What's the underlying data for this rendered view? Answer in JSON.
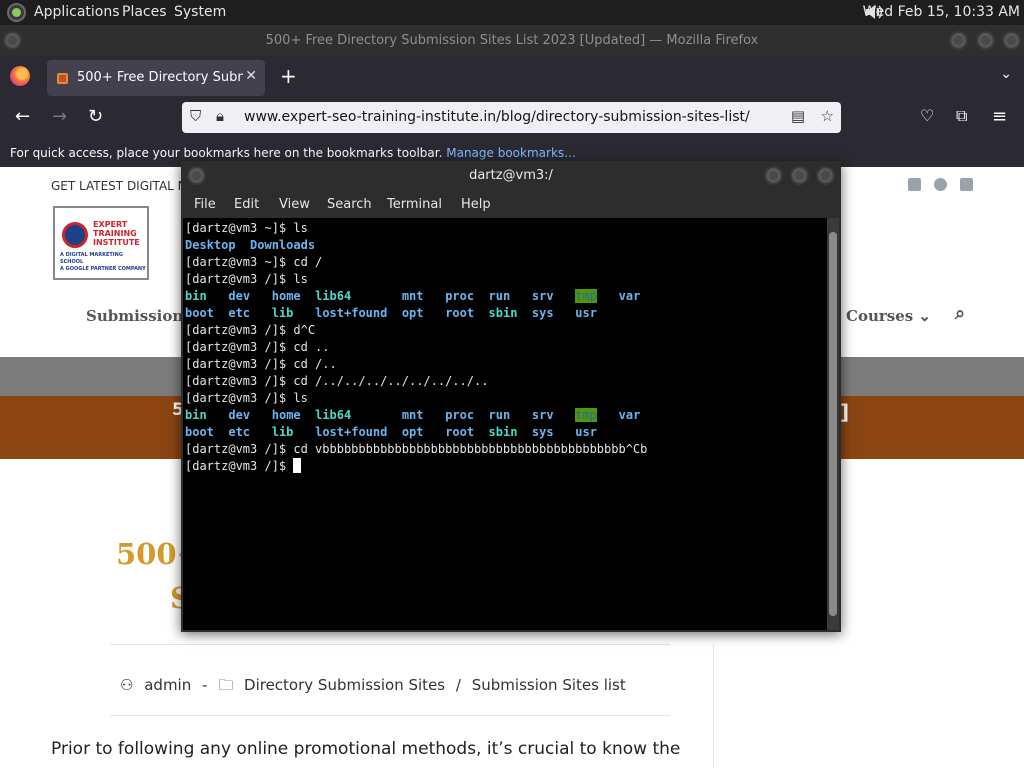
{
  "panel": {
    "menus": [
      "Applications",
      "Places",
      "System"
    ],
    "clock": "Wed Feb 15, 10:33 AM"
  },
  "firefox": {
    "window_title": "500+ Free Directory Submission Sites List 2023 [Updated] — Mozilla Firefox",
    "tab_title": "500+ Free Directory Submis",
    "url": "www.expert-seo-training-institute.in/blog/directory-submission-sites-list/",
    "bookmarks_text": "For quick access, place your bookmarks here on the bookmarks toolbar.",
    "bookmarks_link": "Manage bookmarks…"
  },
  "webpage": {
    "topline": "GET LATEST DIGITAL MA",
    "logo_lines": [
      "EXPERT",
      "TRAINING",
      "INSTITUTE"
    ],
    "logo_sub": [
      "A DIGITAL MARKETING SCHOOL",
      "A GOOGLE PARTNER COMPANY"
    ],
    "nav_left": "Submission S",
    "nav_right": "Courses",
    "banner_left": "5",
    "banner_right": "]",
    "heading_line1": "500+",
    "heading_line2": "S",
    "author": "admin",
    "category1": "Directory Submission Sites",
    "category2": "Submission Sites list",
    "paragraph": "Prior to following any online promotional methods, it’s crucial to know the"
  },
  "terminal": {
    "title": "dartz@vm3:/",
    "menu": [
      "File",
      "Edit",
      "View",
      "Search",
      "Terminal",
      "Help"
    ],
    "lines": [
      [
        {
          "t": "[dartz@vm3 ~]$ ls"
        }
      ],
      [
        {
          "t": "Desktop",
          "c": "dir"
        },
        {
          "t": "  "
        },
        {
          "t": "Downloads",
          "c": "dir"
        }
      ],
      [
        {
          "t": "[dartz@vm3 ~]$ cd /"
        }
      ],
      [
        {
          "t": "[dartz@vm3 /]$ ls"
        }
      ],
      [
        {
          "t": "bin",
          "c": "link"
        },
        {
          "t": "   "
        },
        {
          "t": "dev",
          "c": "dir"
        },
        {
          "t": "   "
        },
        {
          "t": "home",
          "c": "dir"
        },
        {
          "t": "  "
        },
        {
          "t": "lib64",
          "c": "link"
        },
        {
          "t": "       "
        },
        {
          "t": "mnt",
          "c": "dir"
        },
        {
          "t": "   "
        },
        {
          "t": "proc",
          "c": "dir"
        },
        {
          "t": "  "
        },
        {
          "t": "run",
          "c": "dir"
        },
        {
          "t": "   "
        },
        {
          "t": "srv",
          "c": "dir"
        },
        {
          "t": "   "
        },
        {
          "t": "tmp",
          "c": "hl"
        },
        {
          "t": "   "
        },
        {
          "t": "var",
          "c": "dir"
        }
      ],
      [
        {
          "t": "boot",
          "c": "dir"
        },
        {
          "t": "  "
        },
        {
          "t": "etc",
          "c": "dir"
        },
        {
          "t": "   "
        },
        {
          "t": "lib",
          "c": "link"
        },
        {
          "t": "   "
        },
        {
          "t": "lost+found",
          "c": "dir"
        },
        {
          "t": "  "
        },
        {
          "t": "opt",
          "c": "dir"
        },
        {
          "t": "   "
        },
        {
          "t": "root",
          "c": "dir"
        },
        {
          "t": "  "
        },
        {
          "t": "sbin",
          "c": "link"
        },
        {
          "t": "  "
        },
        {
          "t": "sys",
          "c": "dir"
        },
        {
          "t": "   "
        },
        {
          "t": "usr",
          "c": "dir"
        }
      ],
      [
        {
          "t": "[dartz@vm3 /]$ d^C"
        }
      ],
      [
        {
          "t": "[dartz@vm3 /]$ cd .."
        }
      ],
      [
        {
          "t": "[dartz@vm3 /]$ cd /.."
        }
      ],
      [
        {
          "t": "[dartz@vm3 /]$ cd /../../../../../../../.."
        }
      ],
      [
        {
          "t": "[dartz@vm3 /]$ ls"
        }
      ],
      [
        {
          "t": "bin",
          "c": "link"
        },
        {
          "t": "   "
        },
        {
          "t": "dev",
          "c": "dir"
        },
        {
          "t": "   "
        },
        {
          "t": "home",
          "c": "dir"
        },
        {
          "t": "  "
        },
        {
          "t": "lib64",
          "c": "link"
        },
        {
          "t": "       "
        },
        {
          "t": "mnt",
          "c": "dir"
        },
        {
          "t": "   "
        },
        {
          "t": "proc",
          "c": "dir"
        },
        {
          "t": "  "
        },
        {
          "t": "run",
          "c": "dir"
        },
        {
          "t": "   "
        },
        {
          "t": "srv",
          "c": "dir"
        },
        {
          "t": "   "
        },
        {
          "t": "tmp",
          "c": "hl"
        },
        {
          "t": "   "
        },
        {
          "t": "var",
          "c": "dir"
        }
      ],
      [
        {
          "t": "boot",
          "c": "dir"
        },
        {
          "t": "  "
        },
        {
          "t": "etc",
          "c": "dir"
        },
        {
          "t": "   "
        },
        {
          "t": "lib",
          "c": "link"
        },
        {
          "t": "   "
        },
        {
          "t": "lost+found",
          "c": "dir"
        },
        {
          "t": "  "
        },
        {
          "t": "opt",
          "c": "dir"
        },
        {
          "t": "   "
        },
        {
          "t": "root",
          "c": "dir"
        },
        {
          "t": "  "
        },
        {
          "t": "sbin",
          "c": "link"
        },
        {
          "t": "  "
        },
        {
          "t": "sys",
          "c": "dir"
        },
        {
          "t": "   "
        },
        {
          "t": "usr",
          "c": "dir"
        }
      ],
      [
        {
          "t": "[dartz@vm3 /]$ cd vbbbbbbbbbbbbbbbbbbbbbbbbbbbbbbbbbbbbbbbbbb^Cb"
        }
      ],
      [
        {
          "t": "[dartz@vm3 /]$ "
        }
      ]
    ]
  },
  "colors": {
    "heading": "#d49a2a",
    "banner": "#8b4513",
    "term_dir": "#6cb4ee",
    "term_link": "#4fd6c7",
    "term_tmp_bg": "#4e9a06"
  }
}
